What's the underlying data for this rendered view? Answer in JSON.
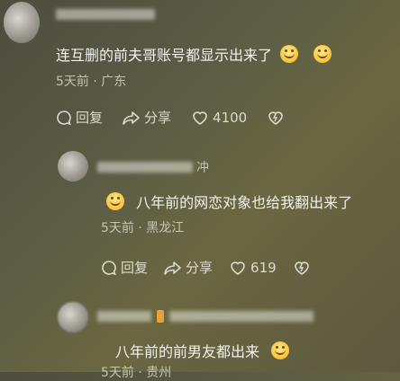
{
  "comment1": {
    "text": "连互删的前夫哥账号都显示出来了",
    "date": "5天前",
    "location": "广东",
    "reply_label": "回复",
    "share_label": "分享",
    "likes": "4100"
  },
  "comment2": {
    "username_tail": "冲",
    "text": "八年前的网恋对象也给我翻出来了",
    "date": "5天前",
    "location": "黑龙江",
    "reply_label": "回复",
    "share_label": "分享",
    "likes": "619"
  },
  "comment3": {
    "text": "八年前的前男友都出来",
    "date": "5天前",
    "location": "贵州"
  },
  "separator": "·",
  "icons": {
    "reply": "reply-bubble-icon",
    "share": "share-arrow-icon",
    "like": "heart-icon",
    "dislike": "broken-heart-icon",
    "emoji": "smile-emoji-icon"
  },
  "colors": {
    "text": "#f3f3f0",
    "meta": "#d6d6c9"
  }
}
